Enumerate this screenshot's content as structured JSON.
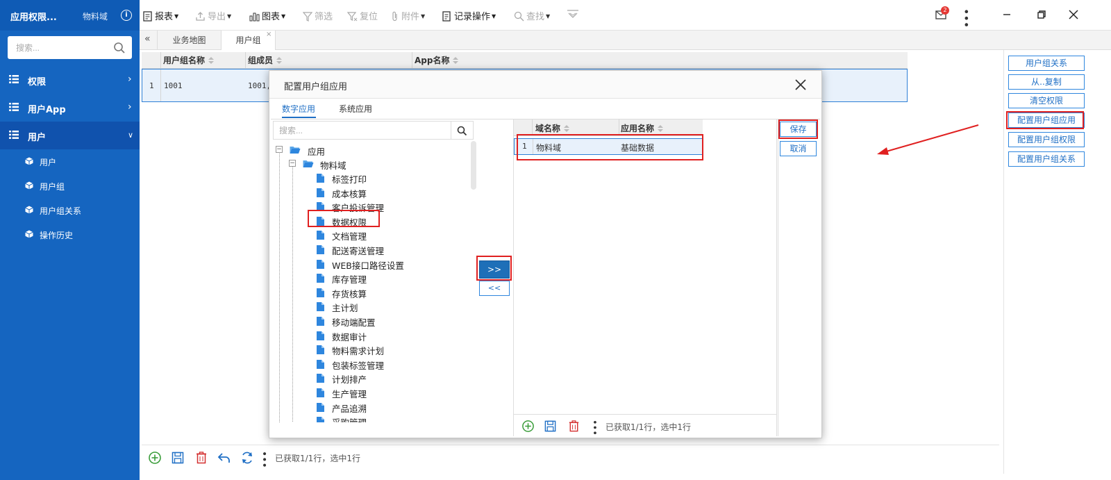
{
  "sidebar": {
    "title": "应用权限...",
    "domain": "物料域",
    "info_icon": "info-icon",
    "search_placeholder": "搜索...",
    "menus": [
      {
        "label": "权限",
        "arrow": "›",
        "expanded": false
      },
      {
        "label": "用户App",
        "arrow": "›",
        "expanded": false
      },
      {
        "label": "用户",
        "arrow": "⌄",
        "expanded": true
      }
    ],
    "subitems": [
      {
        "label": "用户"
      },
      {
        "label": "用户组"
      },
      {
        "label": "用户组关系"
      },
      {
        "label": "操作历史"
      }
    ],
    "colors": {
      "bg": "#1565c0",
      "active": "#0d47a1"
    }
  },
  "toolbar": {
    "report": "报表",
    "export": "导出",
    "chart": "图表",
    "filter": "筛选",
    "reset": "复位",
    "attach": "附件",
    "record_ops": "记录操作",
    "find": "查找",
    "mail_badge": "2"
  },
  "tabs": {
    "collapse": "«",
    "items": [
      {
        "label": "业务地图",
        "active": false
      },
      {
        "label": "用户组",
        "active": true,
        "close": "×"
      }
    ]
  },
  "grid": {
    "columns": [
      "用户组名称",
      "组成员",
      "App名称"
    ],
    "rows": [
      {
        "num": "1",
        "name": "1001",
        "members": "1001,"
      }
    ]
  },
  "right_buttons": [
    {
      "label": "用户组关系"
    },
    {
      "label": "从..复制"
    },
    {
      "label": "清空权限"
    },
    {
      "label": "配置用户组应用",
      "highlighted": true
    },
    {
      "label": "配置用户组权限"
    },
    {
      "label": "配置用户组关系"
    }
  ],
  "bottom": {
    "status": "已获取1/1行，选中1行"
  },
  "modal": {
    "title": "配置用户组应用",
    "tabs": [
      {
        "label": "数字应用",
        "active": true
      },
      {
        "label": "系统应用",
        "active": false
      }
    ],
    "search_placeholder": "搜索...",
    "tree": {
      "root": "应用",
      "domain": "物料域",
      "leaves": [
        "标签打印",
        "成本核算",
        "客户投诉管理",
        "数据权限",
        "文档管理",
        "配送寄送管理",
        "WEB接口路径设置",
        "库存管理",
        "存货核算",
        "主计划",
        "移动端配置",
        "数据审计",
        "物料需求计划",
        "包装标签管理",
        "计划排产",
        "生产管理",
        "产品追溯",
        "采购管理"
      ],
      "highlighted_leaf": "数据权限"
    },
    "move_right": ">>",
    "move_left": "<<",
    "right_grid": {
      "columns": [
        "域名称",
        "应用名称"
      ],
      "rows": [
        {
          "num": "1",
          "domain": "物料域",
          "app": "基础数据"
        }
      ],
      "status": "已获取1/1行，选中1行"
    },
    "save": "保存",
    "cancel": "取消"
  },
  "annotation": {
    "color": "#e02020"
  }
}
